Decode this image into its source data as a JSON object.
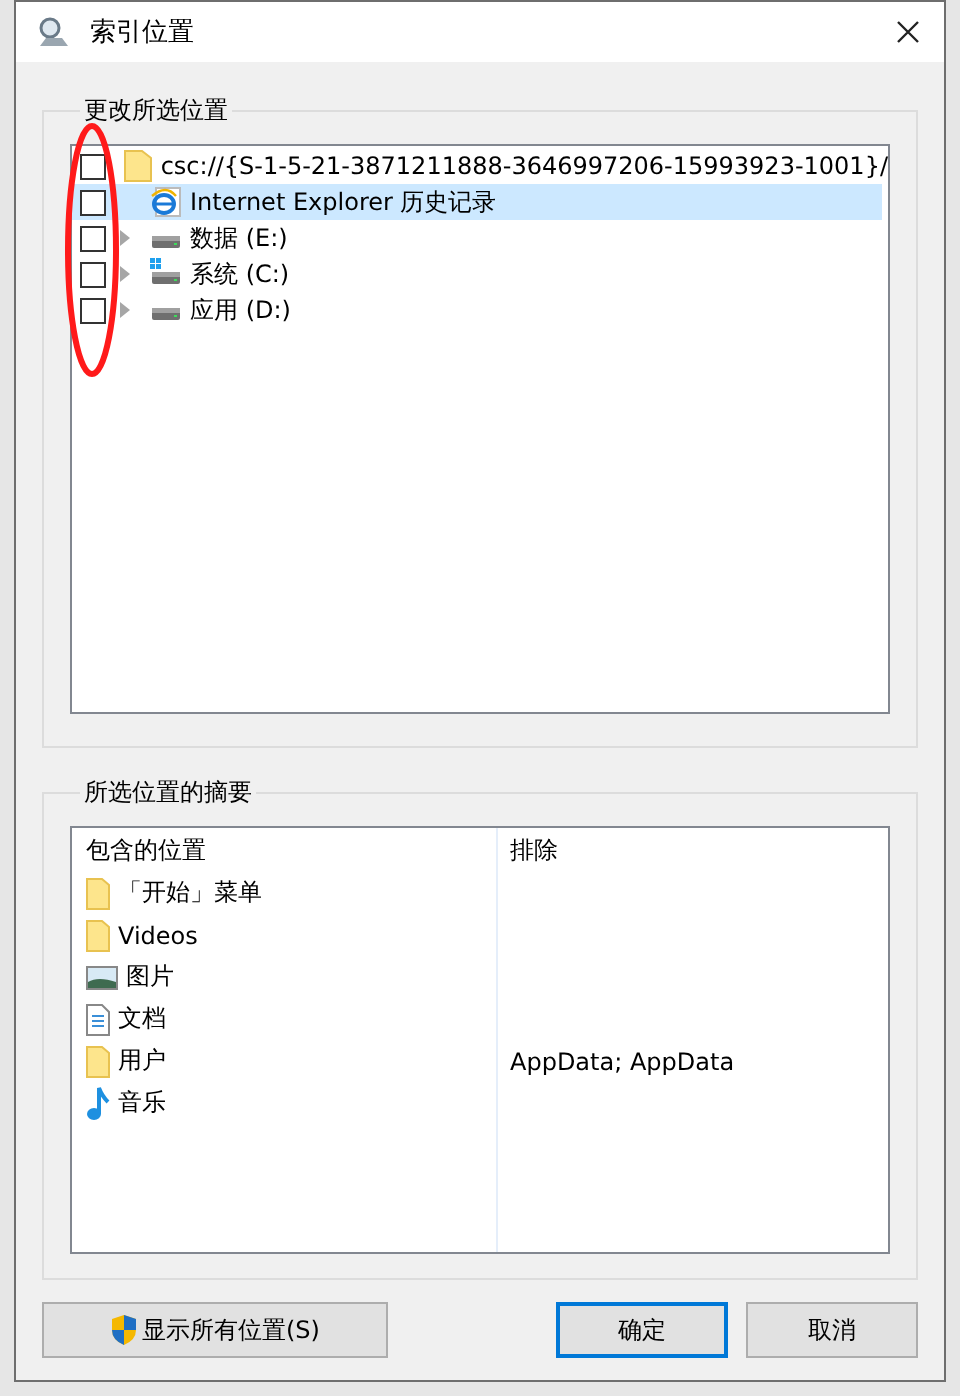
{
  "window": {
    "title": "索引位置"
  },
  "change_group": {
    "label": "更改所选位置",
    "items": [
      {
        "kind": "folder",
        "label": "csc://{S-1-5-21-3871211888-3646997206-15993923-1001}/",
        "checked": false,
        "expandable": false,
        "selected": false
      },
      {
        "kind": "ie",
        "label": "Internet Explorer 历史记录",
        "checked": false,
        "expandable": false,
        "selected": true
      },
      {
        "kind": "drive",
        "label": "数据 (E:)",
        "checked": false,
        "expandable": true,
        "selected": false
      },
      {
        "kind": "system-drive",
        "label": "系统 (C:)",
        "checked": false,
        "expandable": true,
        "selected": false
      },
      {
        "kind": "drive",
        "label": "应用 (D:)",
        "checked": false,
        "expandable": true,
        "selected": false
      }
    ]
  },
  "summary_group": {
    "label": "所选位置的摘要",
    "columns": [
      "包含的位置",
      "排除"
    ],
    "rows": [
      {
        "kind": "folder",
        "included": "「开始」菜单",
        "excluded": ""
      },
      {
        "kind": "folder",
        "included": "Videos",
        "excluded": ""
      },
      {
        "kind": "pictures",
        "included": "图片",
        "excluded": ""
      },
      {
        "kind": "document",
        "included": "文档",
        "excluded": ""
      },
      {
        "kind": "folder",
        "included": "用户",
        "excluded": "AppData; AppData"
      },
      {
        "kind": "music",
        "included": "音乐",
        "excluded": ""
      }
    ]
  },
  "buttons": [
    {
      "kind": "shield",
      "label": "显示所有位置(S)",
      "default": false
    },
    {
      "kind": "plain",
      "label": "确定",
      "default": true
    },
    {
      "kind": "plain",
      "label": "取消",
      "default": false
    }
  ]
}
